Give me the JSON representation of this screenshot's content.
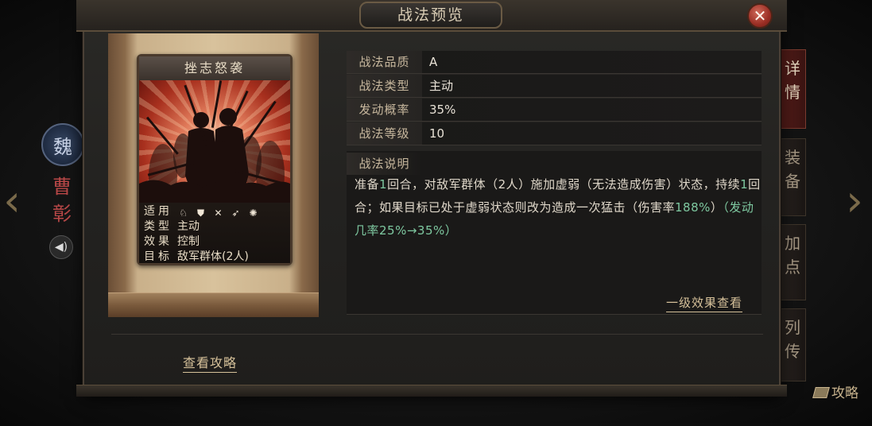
{
  "dialog": {
    "title": "战法预览",
    "close_label": "✕"
  },
  "character": {
    "faction_glyph": "魏",
    "name": "曹彰",
    "speaker_glyph": "◀)"
  },
  "nav": {
    "prev_glyph": "‹",
    "next_glyph": "›"
  },
  "side_tabs": [
    {
      "label": "详情",
      "active": true
    },
    {
      "label": "装备",
      "active": false
    },
    {
      "label": "加点",
      "active": false
    },
    {
      "label": "列传",
      "active": false
    }
  ],
  "corner_guide_label": "攻略",
  "card": {
    "title": "挫志怒袭",
    "troops_key": "适用",
    "troop_icons": [
      "cavalry-icon",
      "shield-icon",
      "bow-icon",
      "spear-icon",
      "chariot-icon"
    ],
    "troop_glyphs": [
      "♘",
      "⛊",
      "✕",
      "➶",
      "✺"
    ],
    "type_key": "类型",
    "type_value": "主动",
    "effect_key": "效果",
    "effect_value": "控制",
    "target_key": "目标",
    "target_value": "敌军群体(2人)"
  },
  "details": {
    "quality_key": "战法品质",
    "quality_value": "A",
    "type_key": "战法类型",
    "type_value": "主动",
    "rate_key": "发动概率",
    "rate_value": "35%",
    "level_key": "战法等级",
    "level_value": "10",
    "desc_key": "战法说明",
    "desc_part1": "准备",
    "desc_num1": "1",
    "desc_part2": "回合，对敌军群体（2人）施加虚弱（无法造成伤害）状态，持续",
    "desc_num2": "1",
    "desc_part3": "回合；如果目标已处于虚弱状态则改为造成一次猛击（伤害率",
    "desc_dmg": "188%",
    "desc_part4": "）",
    "desc_rate_note": "（发动几率25%→35%）"
  },
  "links": {
    "level_effect": "一级效果查看",
    "view_guide": "查看攻略"
  },
  "colors": {
    "highlight_green": "#7ec8a0",
    "close_red": "#9a2e24",
    "link_gold": "#d6c19a"
  }
}
